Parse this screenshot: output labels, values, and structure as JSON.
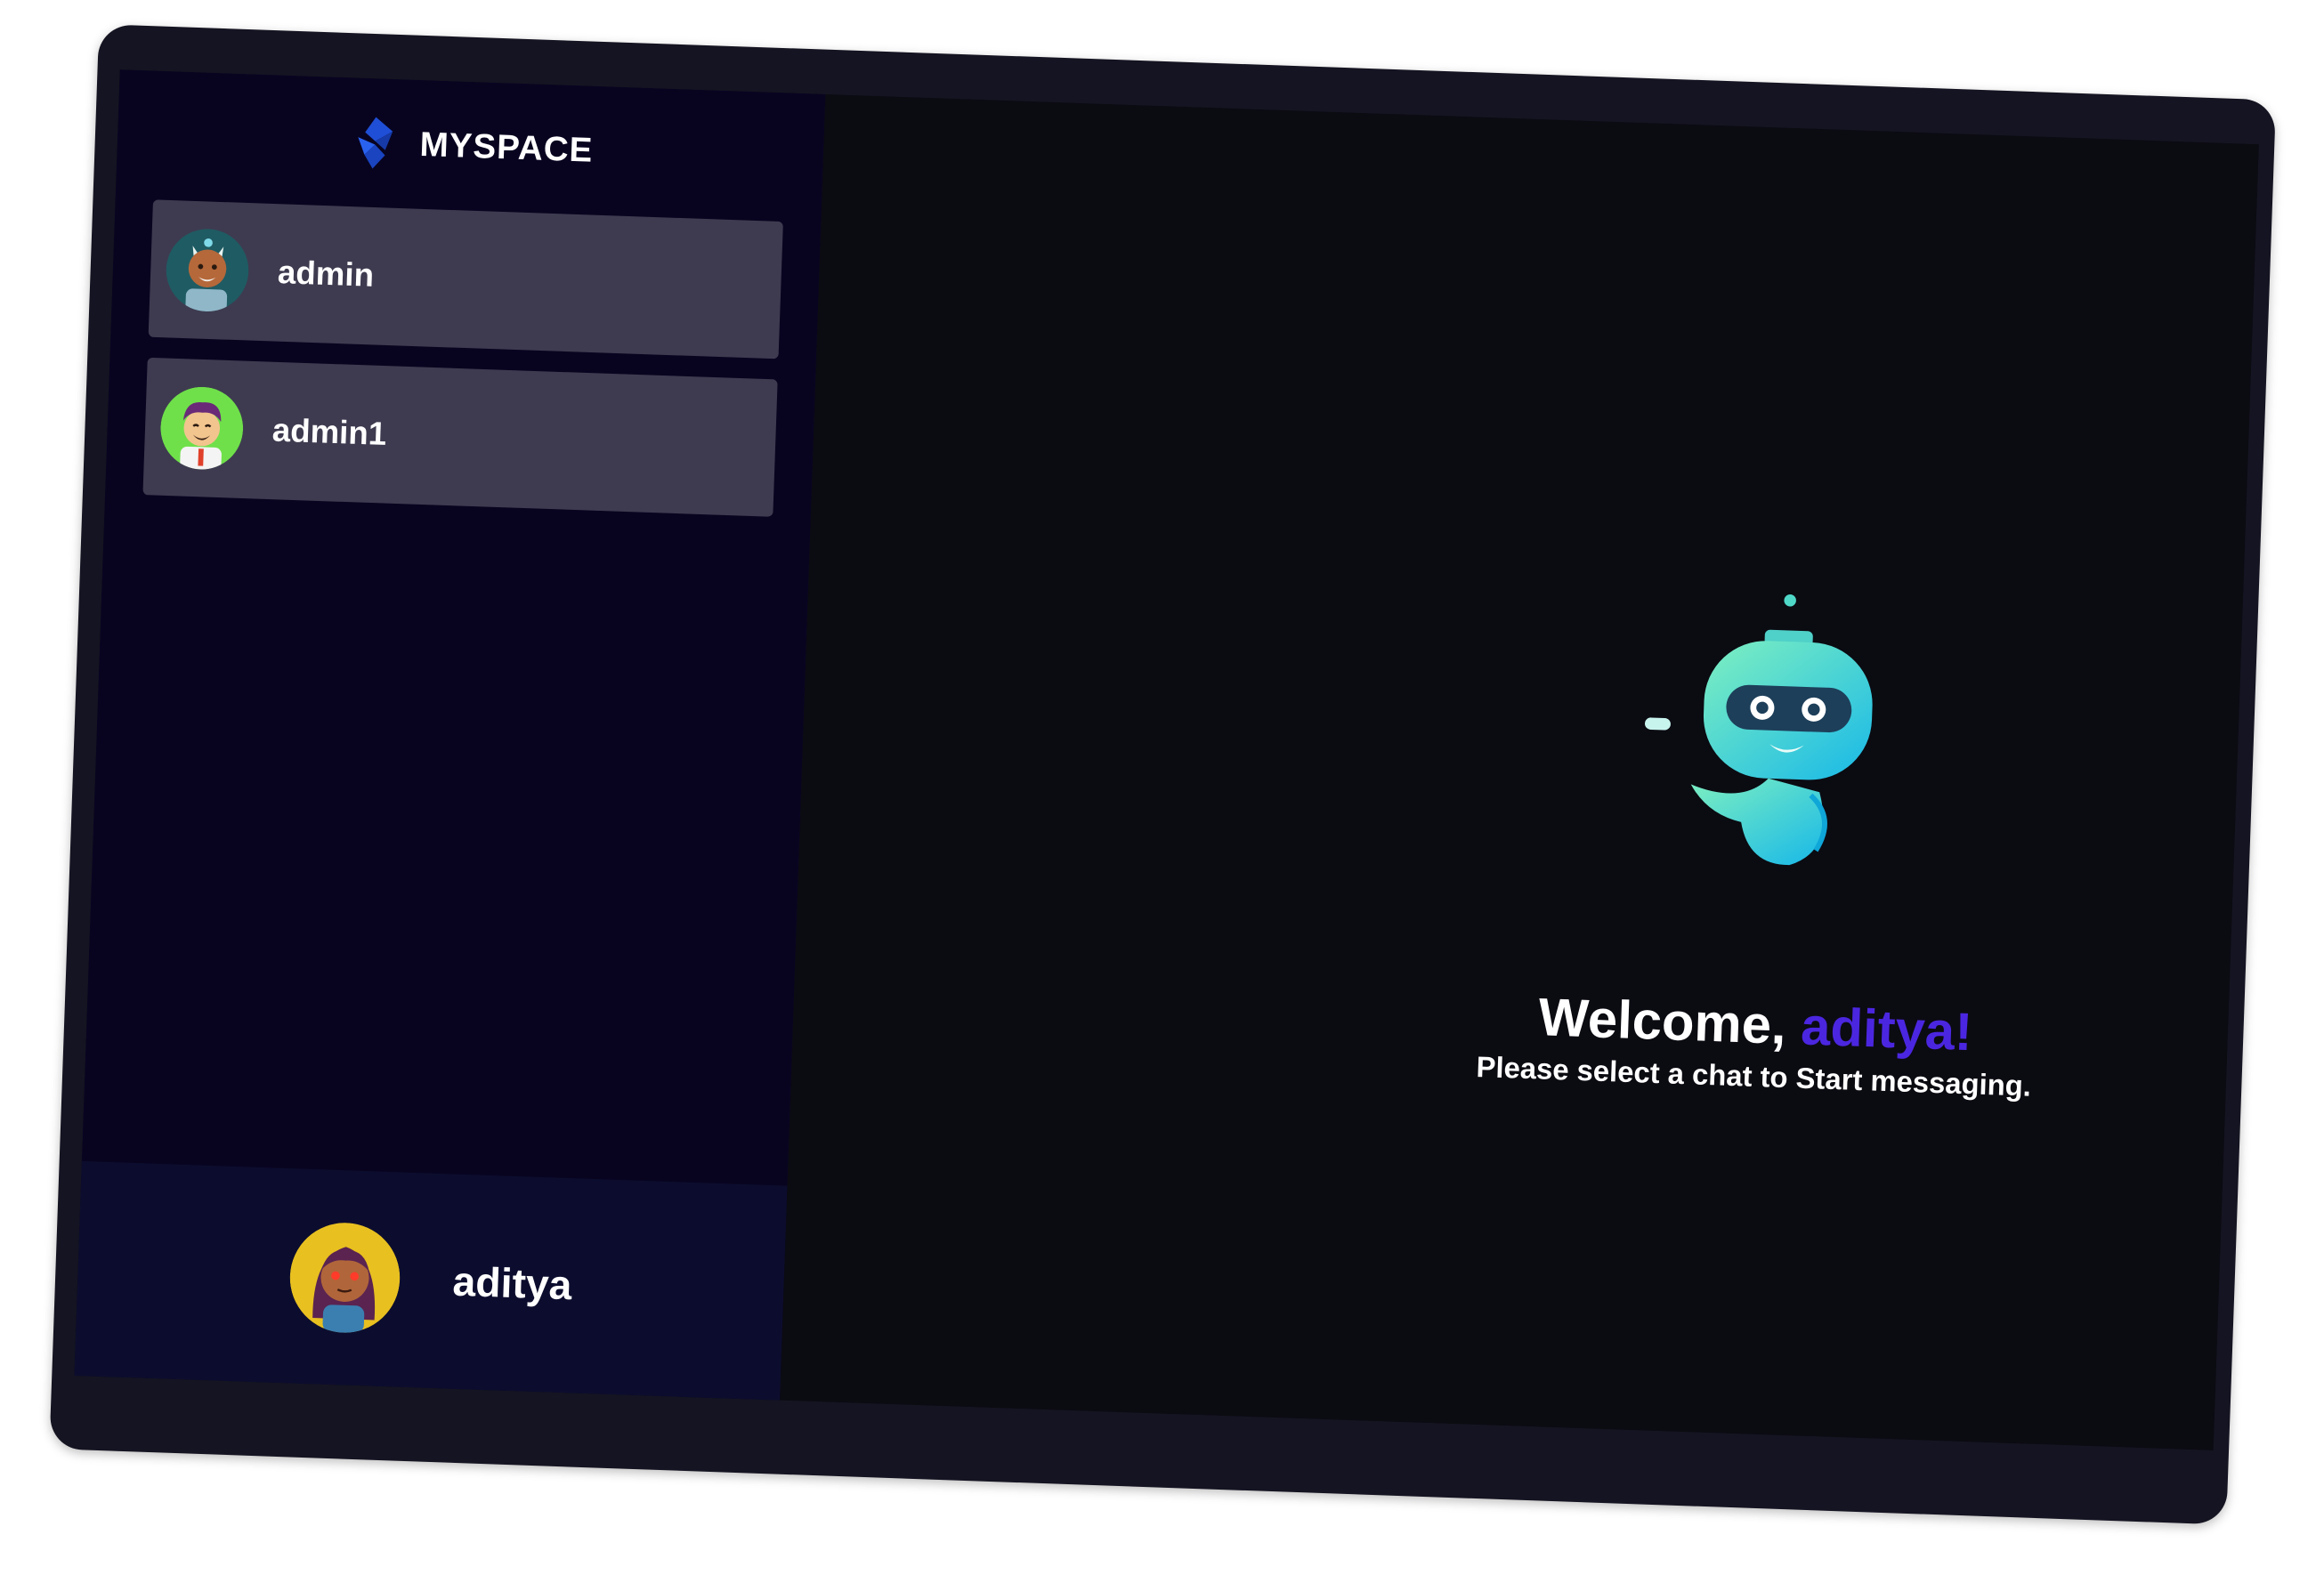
{
  "brand": {
    "name": "MYSPACE",
    "logo_icon": "myspace-logo-icon"
  },
  "contacts": [
    {
      "name": "admin",
      "avatar_icon": "admin-avatar-icon"
    },
    {
      "name": "admin1",
      "avatar_icon": "admin1-avatar-icon"
    }
  ],
  "current_user": {
    "name": "aditya",
    "avatar_icon": "aditya-avatar-icon"
  },
  "welcome": {
    "greeting": "Welcome, ",
    "username": "aditya!",
    "subtitle": "Please select a chat to Start messaging.",
    "illustration_icon": "robot-icon"
  },
  "colors": {
    "frame": "#151422",
    "sidebar": "#080420",
    "contact_card": "#3e3b50",
    "current_user_bar": "#0c0d2e",
    "chat_area": "#0b0b12",
    "accent": "#4b26e0"
  }
}
